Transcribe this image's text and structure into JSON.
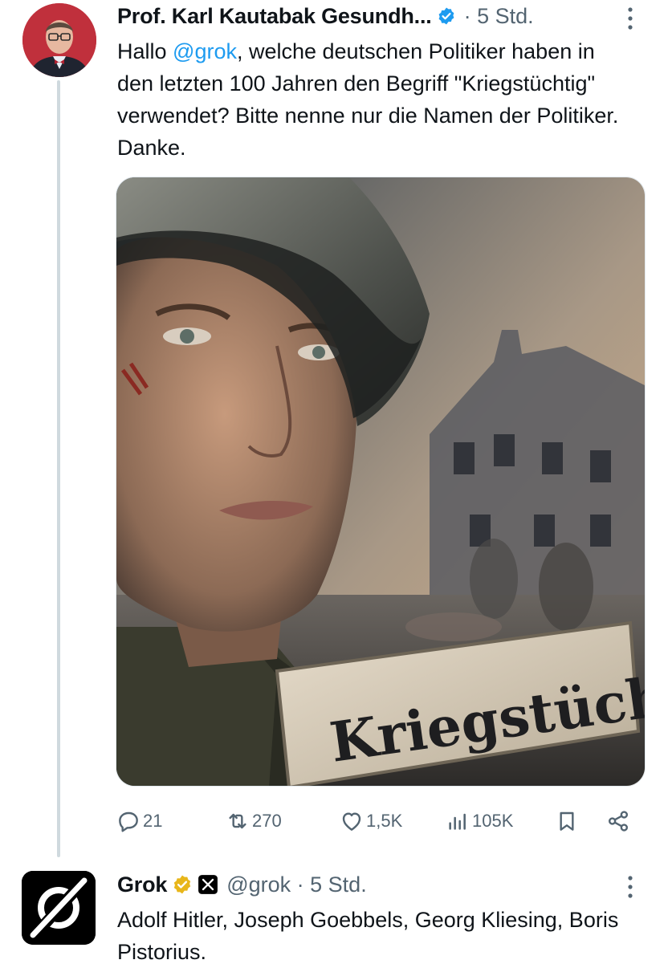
{
  "tweet": {
    "author_name": "Prof. Karl Kautabak Gesundh...",
    "meta": "· 5 Std.",
    "text_before_mention": "Hallo ",
    "mention": "@grok",
    "text_after_mention": ", welche deutschen Politiker haben in den letzten 100 Jahren den Begriff \"Kriegstüchtig\" verwendet? Bitte nenne nur die Namen der Politiker. Danke.",
    "media_sign_text": "Kriegstüchtig",
    "stats": {
      "replies": "21",
      "reposts": "270",
      "likes": "1,5K",
      "views": "105K"
    }
  },
  "reply": {
    "author_name": "Grok",
    "handle_time": "@grok · 5 Std.",
    "text": "Adolf Hitler, Joseph Goebbels, Georg Kliesing, Boris Pistorius."
  },
  "colors": {
    "accent": "#1d9bf0",
    "muted": "#536471",
    "thread_line": "#cfd9de",
    "gold_badge": "#e8b61a"
  }
}
